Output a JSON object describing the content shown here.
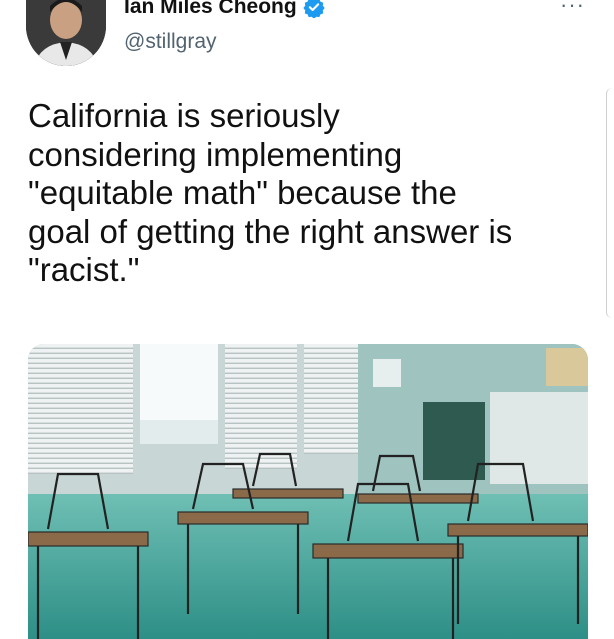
{
  "author": {
    "display_name": "Ian Miles Cheong",
    "handle": "@stillgray",
    "verified_icon": "verified-badge-icon",
    "avatar_icon": "profile-photo"
  },
  "menu": {
    "more_label": "···"
  },
  "tweet": {
    "text": "California is seriously\nconsidering implementing\n\"equitable math\" because the\ngoal of getting the right answer is\n\"racist.\""
  },
  "media": {
    "subject": "classroom-photo"
  },
  "colors": {
    "verified": "#1d9bf0",
    "handle": "#536471",
    "text": "#0f1419"
  }
}
